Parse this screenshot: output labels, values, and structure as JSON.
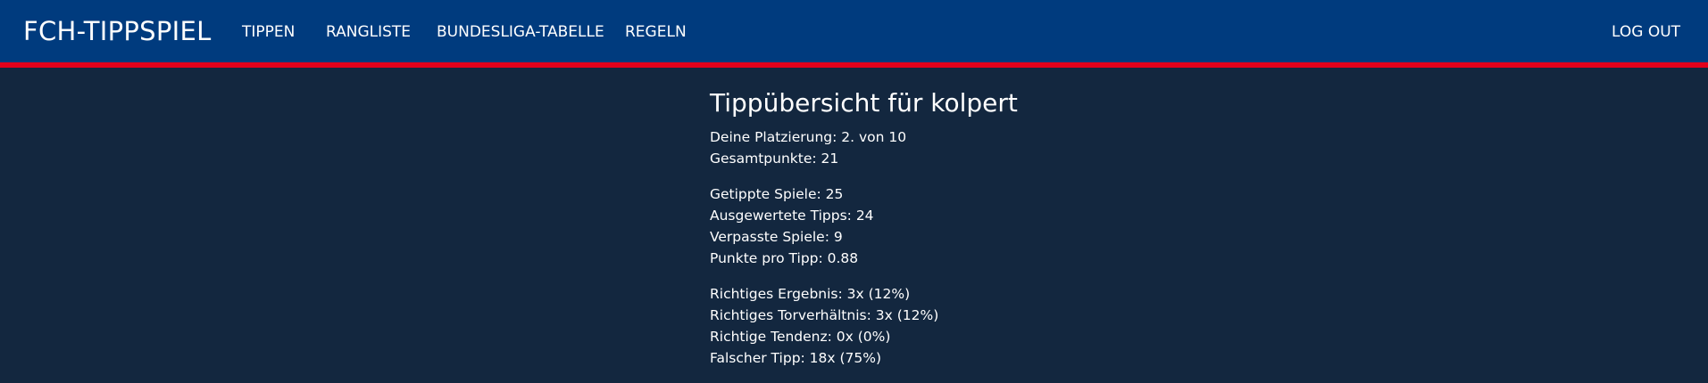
{
  "navbar": {
    "brand": "FCH-TIPPSPIEL",
    "items": [
      {
        "label": "TIPPEN"
      },
      {
        "label": "RANGLISTE"
      },
      {
        "label": "BUNDESLIGA-TABELLE"
      },
      {
        "label": "REGELN"
      }
    ],
    "logout_label": "LOG OUT",
    "colors": {
      "background": "#003b7e",
      "accent": "#e3001b"
    }
  },
  "page": {
    "background_color": "#13273f",
    "title": "Tippübersicht für kolpert",
    "groups": [
      {
        "lines": [
          "Deine Platzierung: 2. von 10",
          "Gesamtpunkte: 21"
        ]
      },
      {
        "lines": [
          "Getippte Spiele: 25",
          "Ausgewertete Tipps: 24",
          "Verpasste Spiele: 9",
          "Punkte pro Tipp: 0.88"
        ]
      },
      {
        "lines": [
          "Richtiges Ergebnis: 3x (12%)",
          "Richtiges Torverhältnis: 3x (12%)",
          "Richtige Tendenz: 0x (0%)",
          "Falscher Tipp: 18x (75%)"
        ]
      }
    ]
  }
}
